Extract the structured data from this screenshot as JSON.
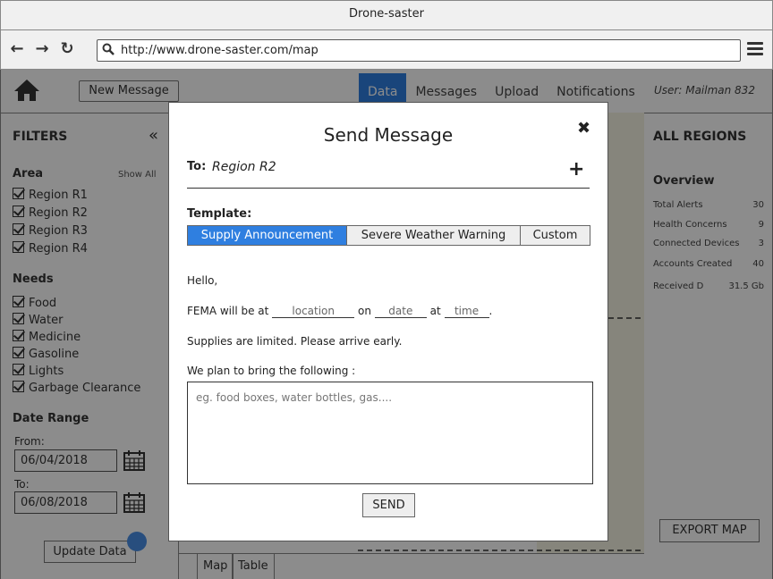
{
  "browser": {
    "window_title": "Drone-saster",
    "url": "http://www.drone-saster.com/map",
    "nav_icons": [
      "back-arrow-icon",
      "forward-arrow-icon",
      "reload-icon"
    ]
  },
  "header": {
    "new_message_label": "New Message",
    "tabs": [
      {
        "label": "Data",
        "active": true
      },
      {
        "label": "Messages",
        "active": false
      },
      {
        "label": "Upload",
        "active": false
      },
      {
        "label": "Notifications",
        "active": false
      }
    ],
    "user_label": "User: Mailman 832",
    "accent_color": "#2f7fe0"
  },
  "sidebar": {
    "title": "FILTERS",
    "collapse_glyph": "«",
    "area": {
      "label": "Area",
      "show_all": "Show All",
      "items": [
        "Region R1",
        "Region R2",
        "Region R3",
        "Region R4"
      ]
    },
    "needs": {
      "label": "Needs",
      "items": [
        "Food",
        "Water",
        "Medicine",
        "Gasoline",
        "Lights",
        "Garbage Clearance"
      ]
    },
    "date_range": {
      "label": "Date Range",
      "from_label": "From:",
      "from_value": "06/04/2018",
      "to_label": "To:",
      "to_value": "06/08/2018"
    },
    "update_label": "Update Data"
  },
  "map": {
    "bottom_tabs": [
      "Map",
      "Table"
    ]
  },
  "right_panel": {
    "title": "ALL REGIONS",
    "overview_label": "Overview",
    "stats": [
      {
        "label": "Total Alerts",
        "value": "30"
      },
      {
        "label": "Health Concerns",
        "value": "9"
      },
      {
        "label": "Connected Devices",
        "value": "3"
      },
      {
        "label": "Accounts Created",
        "value": "40"
      },
      {
        "label": "Received D",
        "value": "31.5 Gb"
      }
    ],
    "export_label": "EXPORT MAP"
  },
  "modal": {
    "title": "Send Message",
    "close_glyph": "✖",
    "to_label": "To:",
    "to_value": "Region R2",
    "add_glyph": "+",
    "template_label": "Template:",
    "templates": [
      {
        "label": "Supply Announcement",
        "active": true
      },
      {
        "label": "Severe Weather Warning",
        "active": false
      },
      {
        "label": "Custom",
        "active": false
      }
    ],
    "greeting": "Hello,",
    "line1": {
      "prefix": "FEMA will be at",
      "location": "location",
      "on": "on",
      "date": "date",
      "at": "at",
      "time": "time",
      "suffix": "."
    },
    "line2": "Supplies are limited. Please arrive early.",
    "line3": "We plan to bring the following :",
    "textarea_placeholder": "eg. food boxes, water bottles, gas....",
    "send_label": "SEND"
  }
}
